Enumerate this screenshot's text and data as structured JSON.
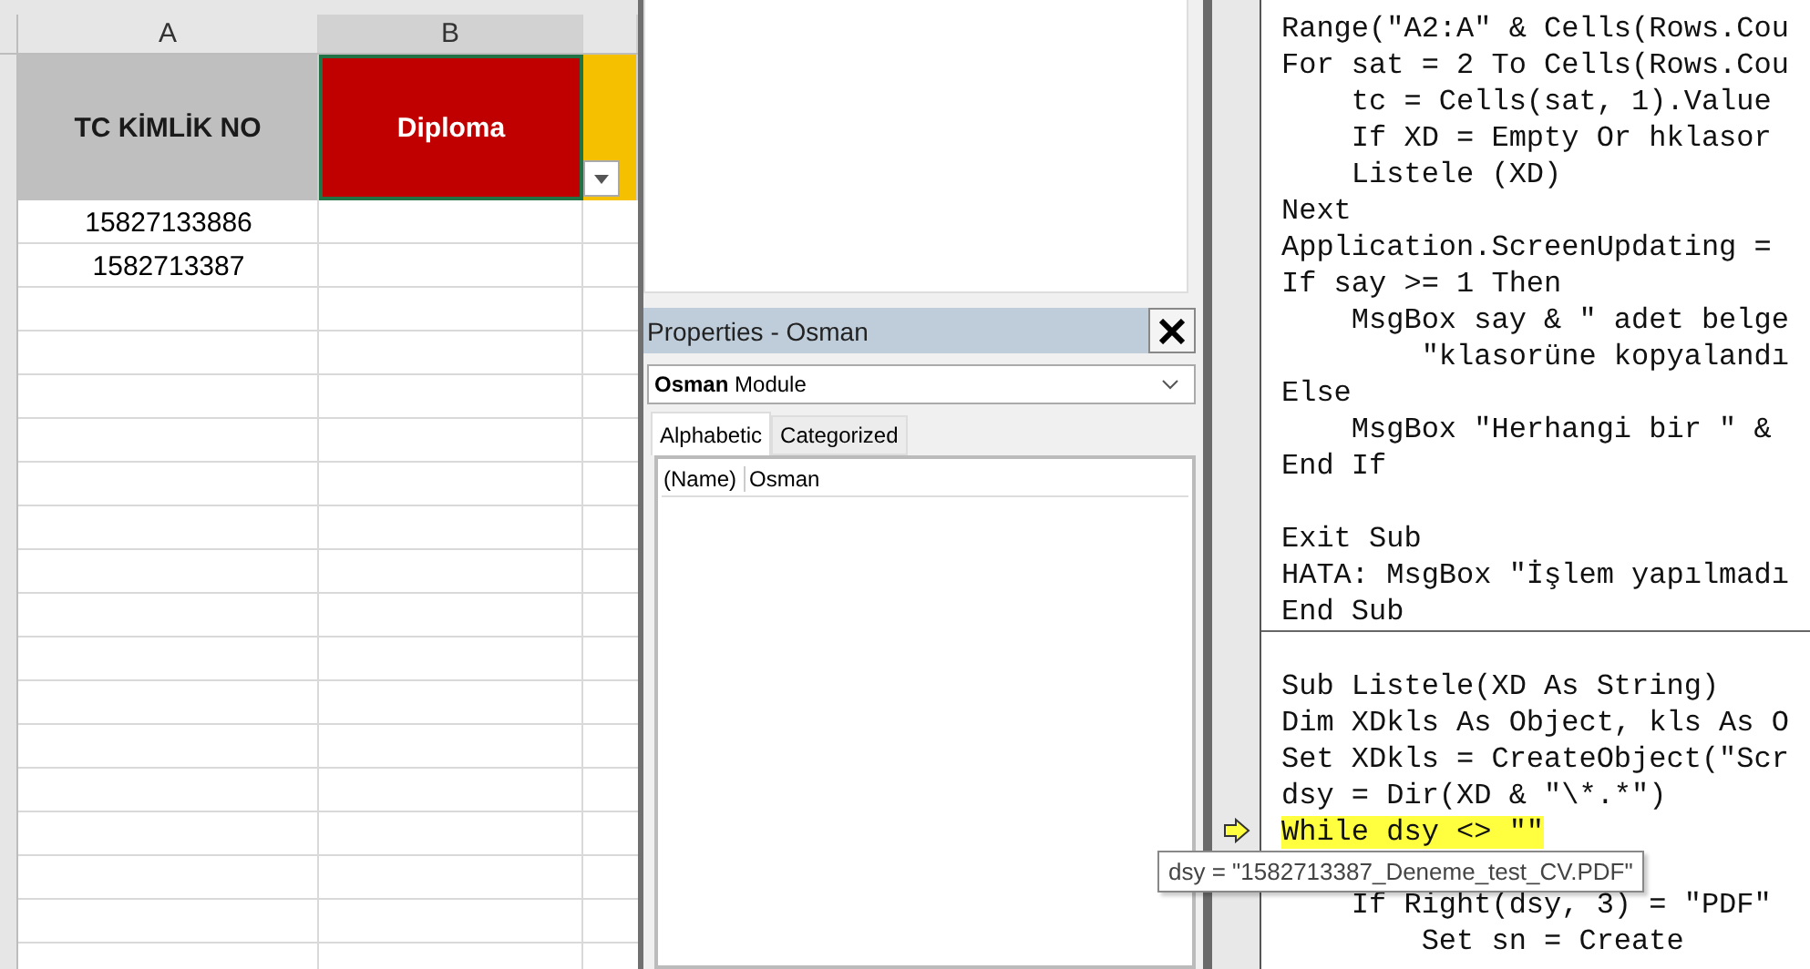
{
  "spreadsheet": {
    "columns": [
      {
        "label": "A"
      },
      {
        "label": "B"
      }
    ],
    "header_cells": [
      {
        "text": "TC KİMLİK NO",
        "color": "#bfbfbf",
        "selected": false
      },
      {
        "text": "Diploma",
        "color": "#c00000",
        "selected": true
      }
    ],
    "rows": [
      "15827133886",
      "1582713387"
    ]
  },
  "properties": {
    "title": "Properties - Osman",
    "object_name": "Osman",
    "object_type": "Module",
    "tabs": [
      {
        "label": "Alphabetic",
        "selected": true
      },
      {
        "label": "Categorized",
        "selected": false
      }
    ],
    "grid": [
      {
        "name": "(Name)",
        "value": "Osman"
      }
    ]
  },
  "code": {
    "blocks": [
      {
        "lines": [
          {
            "kind": "code",
            "text": "Range(\"A2:A\" & Cells(Rows.Cou",
            "highlighted": false,
            "current": false
          },
          {
            "kind": "code",
            "text": "For sat = 2 To Cells(Rows.Cou",
            "highlighted": false,
            "current": false
          },
          {
            "kind": "code",
            "text": "    tc = Cells(sat, 1).Value",
            "highlighted": false,
            "current": false
          },
          {
            "kind": "code",
            "text": "    If XD = Empty Or hklasor",
            "highlighted": false,
            "current": false
          },
          {
            "kind": "code",
            "text": "    Listele (XD)",
            "highlighted": false,
            "current": false
          },
          {
            "kind": "code",
            "text": "Next",
            "highlighted": false,
            "current": false
          },
          {
            "kind": "code",
            "text": "Application.ScreenUpdating =",
            "highlighted": false,
            "current": false
          },
          {
            "kind": "code",
            "text": "If say >= 1 Then",
            "highlighted": false,
            "current": false
          },
          {
            "kind": "code",
            "text": "    MsgBox say & \" adet belge",
            "highlighted": false,
            "current": false
          },
          {
            "kind": "code",
            "text": "        \"klasorüne kopyalandı",
            "highlighted": false,
            "current": false
          },
          {
            "kind": "code",
            "text": "Else",
            "highlighted": false,
            "current": false
          },
          {
            "kind": "code",
            "text": "    MsgBox \"Herhangi bir \" &",
            "highlighted": false,
            "current": false
          },
          {
            "kind": "code",
            "text": "End If",
            "highlighted": false,
            "current": false
          },
          {
            "kind": "blank"
          },
          {
            "kind": "code",
            "text": "Exit Sub",
            "highlighted": false,
            "current": false
          },
          {
            "kind": "code",
            "text": "HATA: MsgBox \"İşlem yapılmadı",
            "highlighted": false,
            "current": false
          },
          {
            "kind": "code",
            "text": "End Sub",
            "highlighted": false,
            "current": false
          }
        ]
      },
      {
        "lines": [
          {
            "kind": "blank"
          },
          {
            "kind": "code",
            "text": "Sub Listele(XD As String)",
            "highlighted": false,
            "current": false
          },
          {
            "kind": "code",
            "text": "Dim XDkls As Object, kls As O",
            "highlighted": false,
            "current": false
          },
          {
            "kind": "code",
            "text": "Set XDkls = CreateObject(\"Scr",
            "highlighted": false,
            "current": false
          },
          {
            "kind": "code",
            "text": "dsy = Dir(XD & \"\\*.*\")",
            "highlighted": false,
            "current": false
          },
          {
            "kind": "code",
            "text": "While dsy <> \"\"",
            "highlighted": true,
            "current": true
          },
          {
            "kind": "blank"
          },
          {
            "kind": "code",
            "text": "    If Right(dsy, 3) = \"PDF\"",
            "highlighted": false,
            "current": false
          },
          {
            "kind": "code",
            "text": "        Set sn = Create",
            "highlighted": false,
            "current": false
          }
        ]
      }
    ]
  },
  "tooltip": {
    "text": "dsy = \"1582713387_Deneme_test_CV.PDF\""
  }
}
